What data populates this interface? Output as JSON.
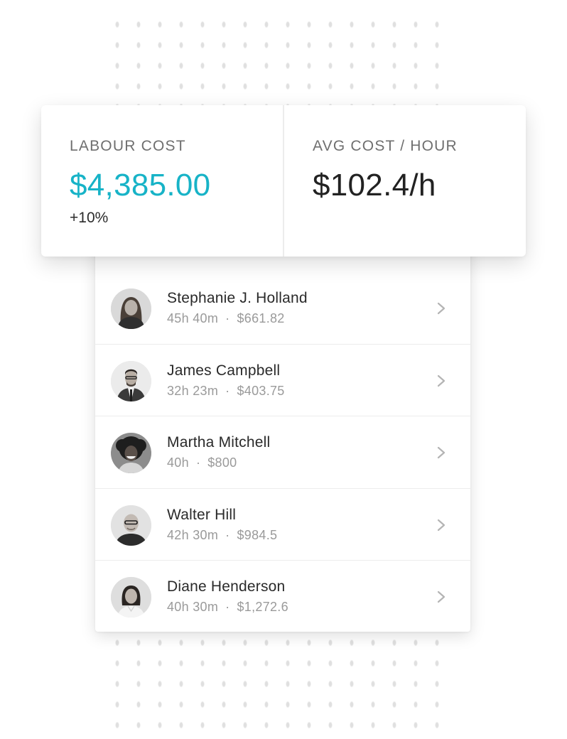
{
  "colors": {
    "accent": "#17b3c7",
    "text_primary": "#2a2a2a",
    "text_secondary": "#9a9a9a"
  },
  "stats": {
    "labour_cost": {
      "label": "LABOUR COST",
      "value": "$4,385.00",
      "change": "+10%"
    },
    "avg_cost": {
      "label": "AVG COST / HOUR",
      "value": "$102.4/h"
    }
  },
  "employees": [
    {
      "name": "Stephanie J. Holland",
      "hours": "45h 40m",
      "cost": "$661.82",
      "avatar": "woman-long-hair"
    },
    {
      "name": "James Campbell",
      "hours": "32h 23m",
      "cost": "$403.75",
      "avatar": "man-suit-glasses"
    },
    {
      "name": "Martha Mitchell",
      "hours": "40h",
      "cost": "$800",
      "avatar": "woman-curly-hair"
    },
    {
      "name": "Walter Hill",
      "hours": "42h 30m",
      "cost": "$984.5",
      "avatar": "man-bald-glasses"
    },
    {
      "name": "Diane Henderson",
      "hours": "40h 30m",
      "cost": "$1,272.6",
      "avatar": "woman-dark-hair"
    }
  ],
  "separator": "·",
  "icons": {
    "row_action": "chevron-right-icon"
  }
}
